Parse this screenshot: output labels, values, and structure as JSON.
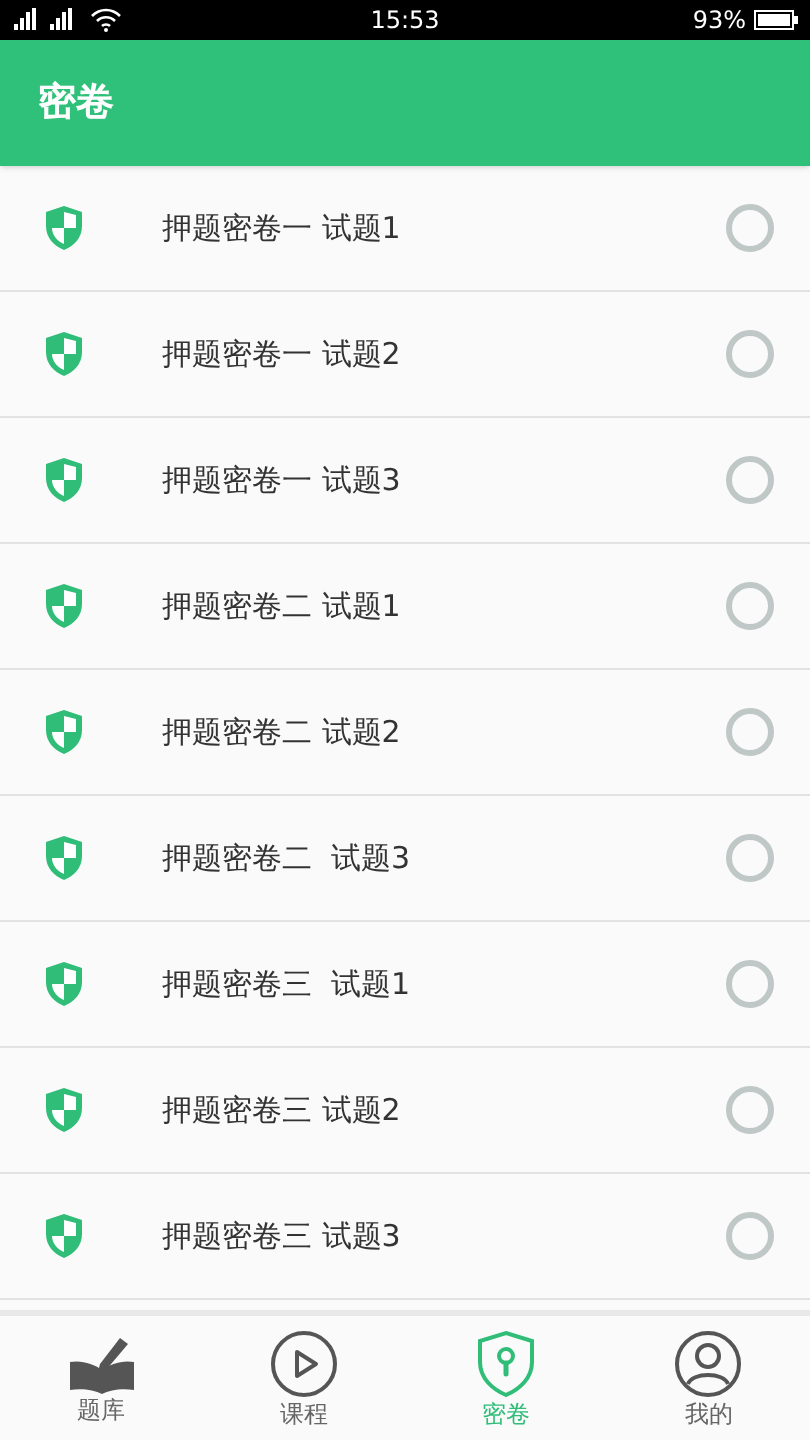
{
  "status_bar": {
    "time": "15:53",
    "battery": "93%"
  },
  "header": {
    "title": "密卷"
  },
  "items": [
    {
      "label": "押题密卷一 试题1",
      "checked": false
    },
    {
      "label": "押题密卷一 试题2",
      "checked": false
    },
    {
      "label": "押题密卷一 试题3",
      "checked": false
    },
    {
      "label": "押题密卷二 试题1",
      "checked": false
    },
    {
      "label": "押题密卷二 试题2",
      "checked": false
    },
    {
      "label": "押题密卷二  试题3",
      "checked": false
    },
    {
      "label": "押题密卷三  试题1",
      "checked": false
    },
    {
      "label": "押题密卷三 试题2",
      "checked": false
    },
    {
      "label": "押题密卷三 试题3",
      "checked": false
    }
  ],
  "nav": [
    {
      "kind": "book",
      "label": "题库",
      "selected": false
    },
    {
      "kind": "play",
      "label": "课程",
      "selected": false
    },
    {
      "kind": "shield",
      "label": "密卷",
      "selected": true
    },
    {
      "kind": "user",
      "label": "我的",
      "selected": false
    }
  ]
}
